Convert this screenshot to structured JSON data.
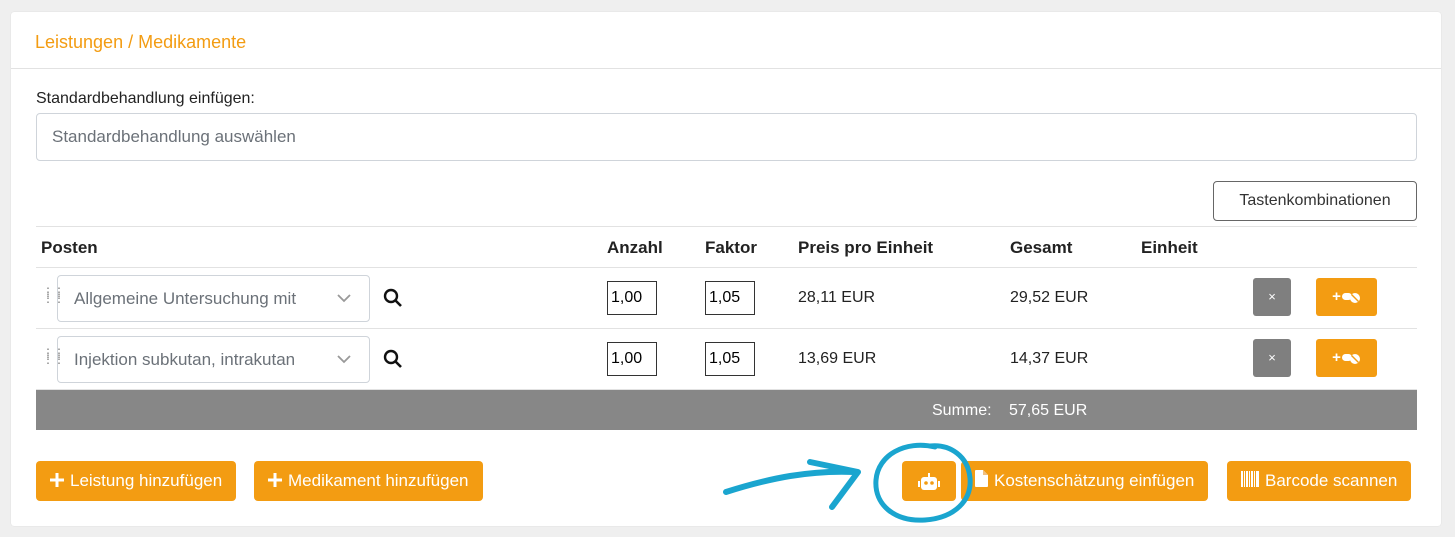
{
  "section_title": "Leistungen / Medikamente",
  "standard": {
    "label": "Standardbehandlung einfügen:",
    "placeholder": "Standardbehandlung auswählen"
  },
  "shortcuts_button": "Tastenkombinationen",
  "table": {
    "headers": {
      "posten": "Posten",
      "anzahl": "Anzahl",
      "faktor": "Faktor",
      "preis": "Preis pro Einheit",
      "gesamt": "Gesamt",
      "einheit": "Einheit"
    },
    "rows": [
      {
        "posten": "Allgemeine Untersuchung mit",
        "anzahl": "1,00",
        "faktor": "1,05",
        "preis": "28,11 EUR",
        "gesamt": "29,52 EUR",
        "einheit": ""
      },
      {
        "posten": "Injektion subkutan, intrakutan",
        "anzahl": "1,00",
        "faktor": "1,05",
        "preis": "13,69 EUR",
        "gesamt": "14,37 EUR",
        "einheit": ""
      }
    ],
    "delete_label": "×",
    "add_med_label": "+",
    "sum_label": "Summe:",
    "sum_value": "57,65 EUR"
  },
  "buttons": {
    "add_service": "Leistung hinzufügen",
    "add_medication": "Medikament hinzufügen",
    "insert_estimate": "Kostenschätzung einfügen",
    "scan_barcode": "Barcode scannen"
  },
  "colors": {
    "accent": "#f39c12",
    "sum_bar": "#878787",
    "delete_button": "#7f7f7f",
    "annotation": "#1aa5cf"
  }
}
